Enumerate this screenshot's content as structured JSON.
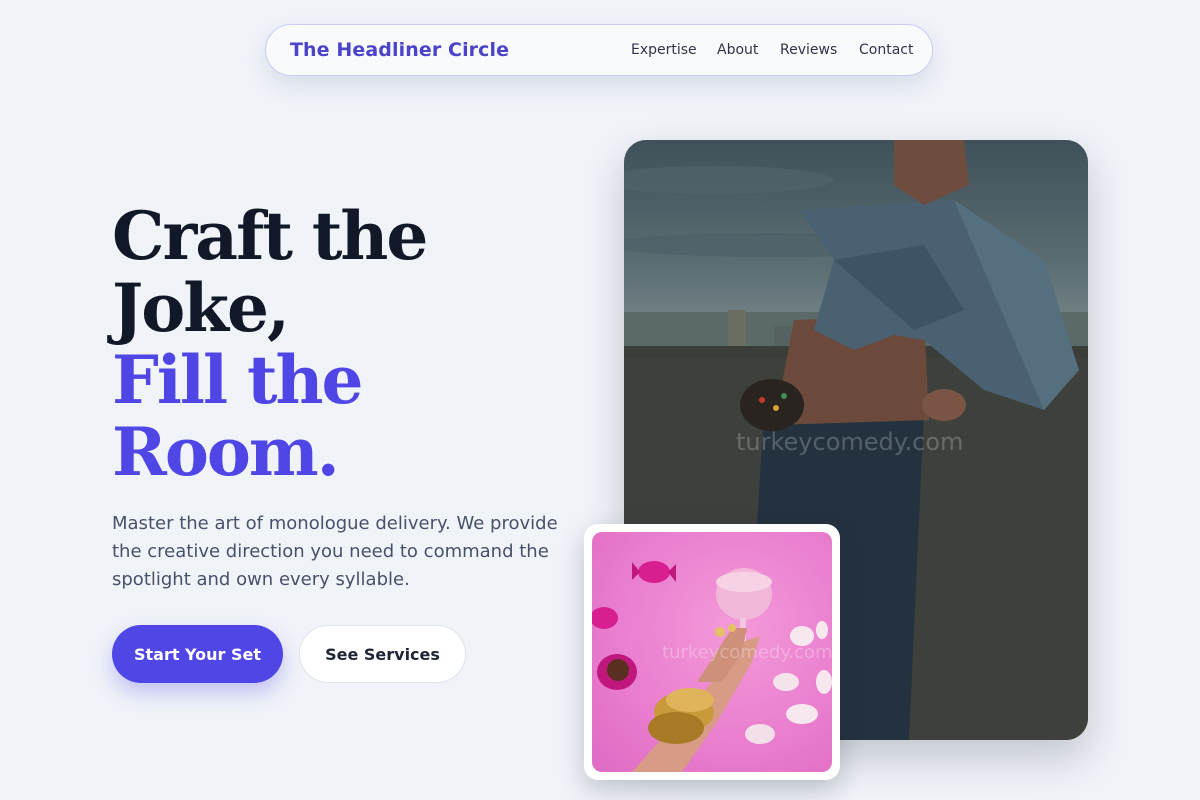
{
  "nav": {
    "brand": "The Headliner Circle",
    "links": [
      {
        "label": "Expertise"
      },
      {
        "label": "About"
      },
      {
        "label": "Reviews"
      },
      {
        "label": "Contact"
      }
    ]
  },
  "hero": {
    "headline": {
      "line1": "Craft the",
      "line2": "Joke,",
      "line3": "Fill the",
      "line4": "Room."
    },
    "lead": "Master the art of monologue delivery. We provide the creative direction you need to command the spotlight and own every syllable.",
    "primary_cta": "Start Your Set",
    "secondary_cta": "See Services"
  },
  "images": {
    "main_watermark": "turkeycomedy.com",
    "inset_watermark": "turkeycomedy.com"
  },
  "colors": {
    "accent": "#4f46e5",
    "brand": "#4b44c9",
    "heading": "#111827",
    "body_text": "#475169",
    "background": "#f0f3f8"
  }
}
